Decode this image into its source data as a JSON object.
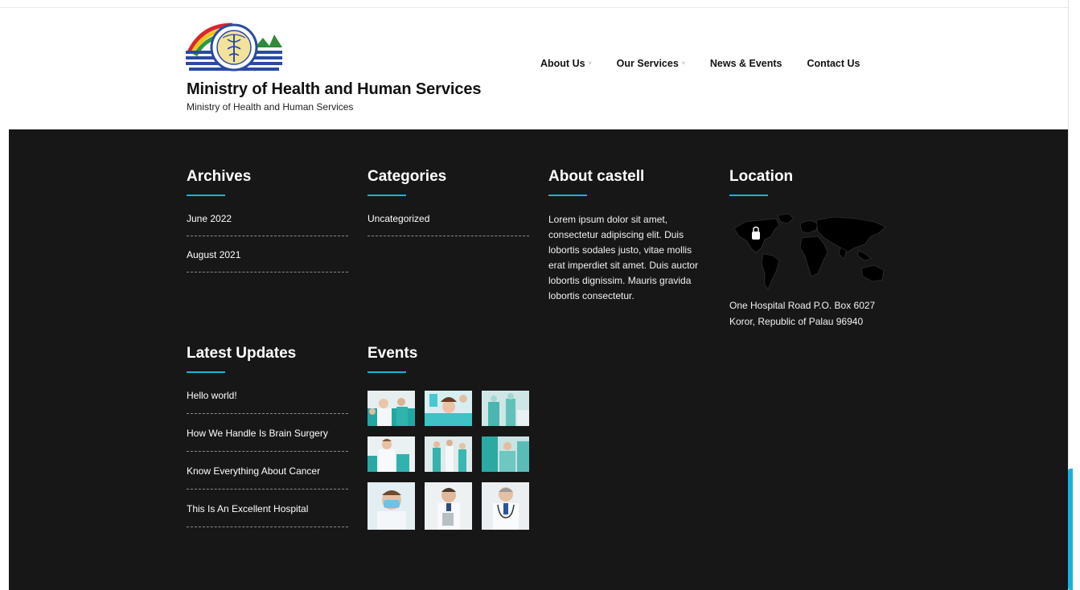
{
  "header": {
    "site_title": "Ministry of Health and Human Services",
    "tagline": "Ministry of Health and Human Services",
    "logo_icon": "ministry-seal-icon",
    "nav": [
      {
        "label": "About Us",
        "has_dropdown": true
      },
      {
        "label": "Our Services",
        "has_dropdown": true
      },
      {
        "label": "News & Events",
        "has_dropdown": false
      },
      {
        "label": "Contact Us",
        "has_dropdown": false
      }
    ],
    "dropdown_glyph": "˅"
  },
  "footer": {
    "archives": {
      "title": "Archives",
      "items": [
        "June 2022",
        "August 2021"
      ]
    },
    "categories": {
      "title": "Categories",
      "items": [
        "Uncategorized"
      ]
    },
    "about": {
      "title": "About castell",
      "text": "Lorem ipsum dolor sit amet, consectetur adipiscing elit. Duis lobortis sodales justo, vitae mollis erat imperdiet sit amet. Duis auctor lobortis dignissim. Mauris gravida lobortis consectetur."
    },
    "location": {
      "title": "Location",
      "address_line1": "One Hospital Road P.O. Box 6027",
      "address_line2": "Koror, Republic of Palau 96940",
      "map_icon": "world-map-icon"
    },
    "updates": {
      "title": "Latest Updates",
      "items": [
        "Hello world!",
        "How We Handle Is Brain Surgery",
        "Know Everything About Cancer",
        "This Is An Excellent Hospital"
      ]
    },
    "events": {
      "title": "Events",
      "thumbnails": [
        "medical-team-photo",
        "dentist-patient-photo",
        "surgery-room-photo",
        "doctors-group-photo",
        "nurses-hallway-photo",
        "operating-team-photo",
        "masked-doctor-photo",
        "doctor-clipboard-photo",
        "doctor-stethoscope-photo"
      ]
    }
  },
  "colors": {
    "accent": "#1cb1dc",
    "footer_bg": "#171717",
    "header_bg": "#ffffff"
  }
}
